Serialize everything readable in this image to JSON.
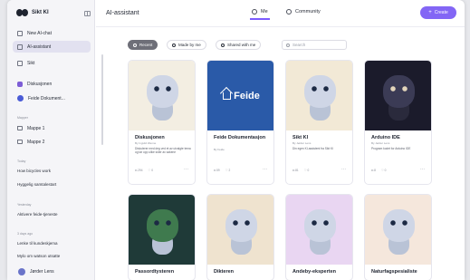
{
  "sidebar": {
    "brand": "Sikt KI",
    "items": [
      {
        "label": "New AI-chat"
      },
      {
        "label": "AI-assistant"
      },
      {
        "label": "Sikt"
      },
      {
        "label": "Diskusjonen"
      },
      {
        "label": "Feide Dokument..."
      },
      {
        "label": "Mappe 1"
      },
      {
        "label": "Mappe 2"
      }
    ],
    "sections": [
      "Mapper",
      "Today",
      "Yesterday",
      "3 days ago"
    ],
    "chats": [
      "How bicycles work",
      "Hyggelig samtalestart",
      "Aktivere feide-tjeneste",
      "Lenke til kundeskjema",
      "Mylo om watson utsatte"
    ],
    "user": "Jørder Lens"
  },
  "topbar": {
    "title": "AI-assistant",
    "tabs": [
      {
        "label": "Me"
      },
      {
        "label": "Community"
      }
    ],
    "create_label": "Create"
  },
  "filters": {
    "chips": [
      "Recent",
      "Made by me",
      "Shared with me"
    ],
    "search_placeholder": "Search"
  },
  "cards": [
    {
      "title": "Diskusjonen",
      "author": "By Ingvild Wenne",
      "desc": "Diskuterer med deg ved et av utvalgte tema og tar opp ulike sider av sakene",
      "stats": [
        "294",
        "0"
      ],
      "color": "#f3eee2",
      "icon": "robot-speech-icon"
    },
    {
      "title": "Feide Dokumentasjon",
      "author": "By Feide",
      "desc": "",
      "stats": [
        "59",
        "2"
      ],
      "color": "#2a5aa8",
      "icon": "feide-logo-icon",
      "logo_text": "Feide"
    },
    {
      "title": "Sikt KI",
      "author": "By Jørder Lens",
      "desc": "Din egen KI-assistent fra Sikt KI",
      "stats": [
        "81",
        "0"
      ],
      "color": "#f2e9d6",
      "icon": "robot-headset-icon"
    },
    {
      "title": "Arduino IDE",
      "author": "By Jørder Lens",
      "desc": "Program kodet for Arduino IDE",
      "stats": [
        "8",
        "0"
      ],
      "color": "#1b1b2b",
      "icon": "glow-robot-icon"
    },
    {
      "title": "Passordtysteren",
      "author": "By Jørder Lens",
      "desc": "",
      "stats": [],
      "color": "#1f3a38",
      "icon": "witch-icon"
    },
    {
      "title": "Dikteren",
      "author": "By Jørder Lens",
      "desc": "",
      "stats": [],
      "color": "#efe3cf",
      "icon": "owl-book-icon"
    },
    {
      "title": "Andeby-eksperten",
      "author": "By Jørder Lens",
      "desc": "",
      "stats": [],
      "color": "#e9d6f2",
      "icon": "robot-duck-icon"
    },
    {
      "title": "Naturfagspesialiste",
      "author": "By Jørder Lens",
      "desc": "",
      "stats": [],
      "color": "#f5e7dc",
      "icon": "robot-tv-icon"
    }
  ]
}
